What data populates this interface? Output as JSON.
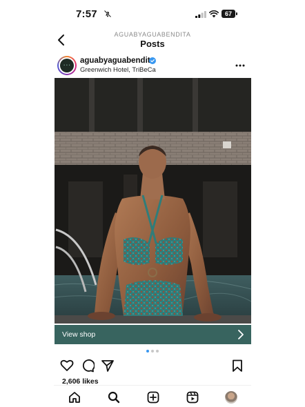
{
  "status_bar": {
    "time": "7:57",
    "battery": "67",
    "icons": [
      "bell-slash-icon",
      "signal-icon",
      "wifi-icon",
      "battery-icon"
    ]
  },
  "header": {
    "account": "AGUABYAGUABENDITA",
    "title": "Posts",
    "back_icon": "chevron-left-icon"
  },
  "post": {
    "username": "aguabyaguabendita",
    "verified": true,
    "location": "Greenwich Hotel, TriBeCa",
    "more_icon": "more-horizontal-icon",
    "shop_label": "View shop",
    "carousel": {
      "count": 3,
      "active": 1
    },
    "likes": "2,606 likes",
    "actions": [
      "heart-icon",
      "comment-icon",
      "share-icon",
      "bookmark-icon"
    ]
  },
  "nav": {
    "items": [
      "home-icon",
      "search-icon",
      "create-icon",
      "reels-icon",
      "profile-avatar"
    ]
  },
  "colors": {
    "accent": "#3897f0",
    "shop_bar": "#305e58",
    "verified": "#3897f0"
  }
}
